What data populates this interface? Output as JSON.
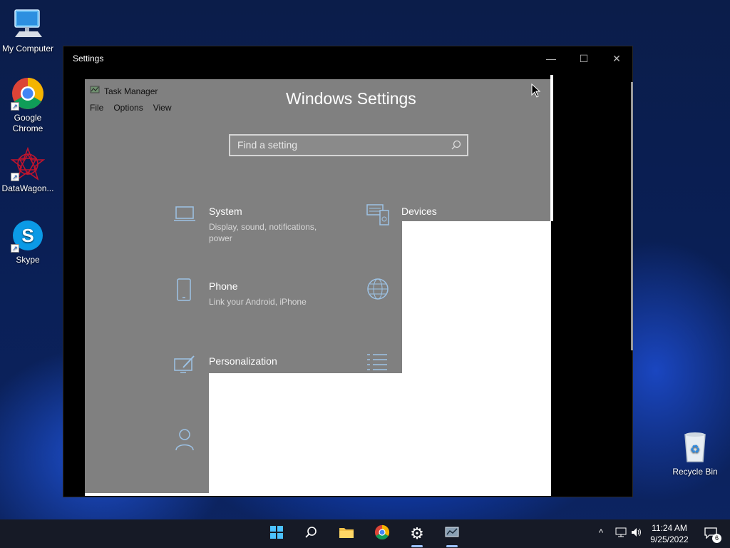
{
  "desktop": {
    "icons": [
      {
        "label": "My Computer"
      },
      {
        "label": "Google Chrome"
      },
      {
        "label": "DataWagon..."
      },
      {
        "label": "Skype"
      },
      {
        "label": "Recycle Bin"
      }
    ]
  },
  "window": {
    "title": "Settings",
    "minimize": "—",
    "maximize": "☐",
    "close": "✕"
  },
  "task_manager": {
    "title": "Task Manager",
    "menu": [
      "File",
      "Options",
      "View"
    ]
  },
  "settings": {
    "heading": "Windows Settings",
    "search": {
      "placeholder": "Find a setting"
    },
    "tiles": [
      {
        "name": "System",
        "desc": "Display, sound, notifications, power",
        "icon": "laptop-icon"
      },
      {
        "name": "Devices",
        "desc": "",
        "icon": "keyboard-devices-icon"
      },
      {
        "name": "Phone",
        "desc": "Link your Android, iPhone",
        "icon": "phone-icon"
      },
      {
        "name": "",
        "desc": "",
        "icon": "globe-icon"
      },
      {
        "name": "Personalization",
        "desc": "",
        "icon": "pen-tablet-icon"
      },
      {
        "name": "",
        "desc": "",
        "icon": "list-icon"
      },
      {
        "name": "",
        "desc": "",
        "icon": "person-icon"
      }
    ]
  },
  "taskbar": {
    "clock_time": "11:24 AM",
    "clock_date": "9/25/2022",
    "notification_count": "6",
    "tray_chevron": "^"
  },
  "colors": {
    "accent": "#0078d4",
    "content_gray": "#808080"
  }
}
